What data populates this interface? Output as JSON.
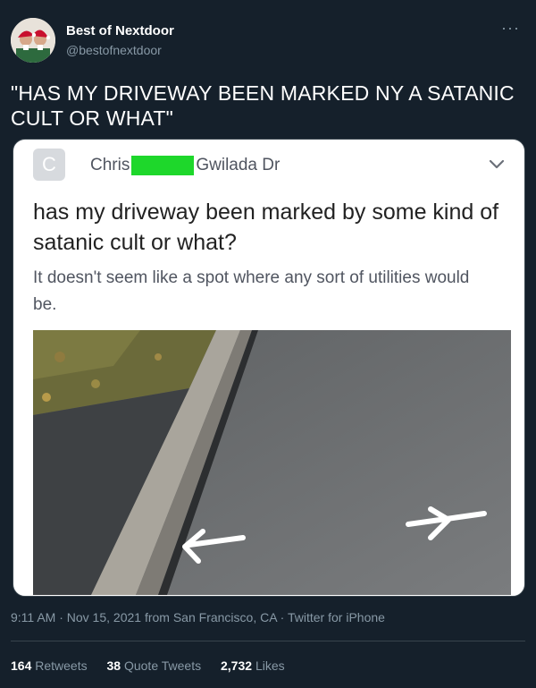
{
  "tweet": {
    "display_name": "Best of Nextdoor",
    "handle": "@bestofnextdoor",
    "more_icon": "···",
    "text": "\"HAS MY DRIVEWAY BEEN MARKED NY A SATANIC CULT OR WHAT\"",
    "timestamp": "9:11 AM · Nov 15, 2021",
    "location_text": "from San Francisco, CA",
    "client": "Twitter for iPhone",
    "stats": [
      {
        "count": "164",
        "label": "Retweets"
      },
      {
        "count": "38",
        "label": "Quote Tweets"
      },
      {
        "count": "2,732",
        "label": "Likes"
      }
    ]
  },
  "embedded_post": {
    "avatar_letter": "C",
    "author_first": "Chris",
    "author_street": "Gwilada Dr",
    "title": "has my driveway been marked by some kind of satanic cult or what?",
    "body": "It doesn't seem like a spot where any sort of utilities would be.",
    "colors": {
      "redaction": "#1ed72b",
      "marking": "#ffffff",
      "asphalt": "#6c6e70"
    }
  },
  "icons": {
    "menu": "chevron-down-icon",
    "more": "more-dots-icon"
  }
}
